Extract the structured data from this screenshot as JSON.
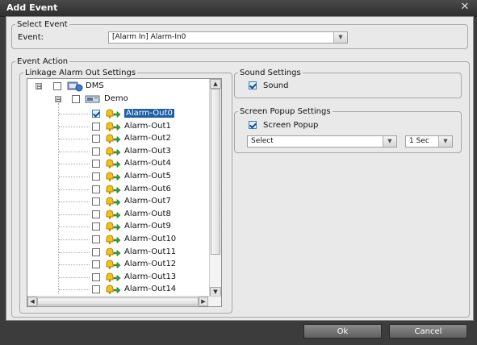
{
  "window": {
    "title": "Add Event",
    "close_glyph": "✕"
  },
  "select_event": {
    "legend": "Select Event",
    "event_label": "Event:",
    "event_value": "[Alarm In] Alarm-In0"
  },
  "event_action": {
    "legend": "Event Action",
    "linkage": {
      "legend": "Linkage Alarm Out Settings",
      "root": {
        "label": "DMS",
        "expander": "⊟"
      },
      "device": {
        "label": "Demo",
        "expander": "⊟"
      },
      "items": [
        {
          "label": "Alarm-Out0",
          "checked": true
        },
        {
          "label": "Alarm-Out1",
          "checked": false
        },
        {
          "label": "Alarm-Out2",
          "checked": false
        },
        {
          "label": "Alarm-Out3",
          "checked": false
        },
        {
          "label": "Alarm-Out4",
          "checked": false
        },
        {
          "label": "Alarm-Out5",
          "checked": false
        },
        {
          "label": "Alarm-Out6",
          "checked": false
        },
        {
          "label": "Alarm-Out7",
          "checked": false
        },
        {
          "label": "Alarm-Out8",
          "checked": false
        },
        {
          "label": "Alarm-Out9",
          "checked": false
        },
        {
          "label": "Alarm-Out10",
          "checked": false
        },
        {
          "label": "Alarm-Out11",
          "checked": false
        },
        {
          "label": "Alarm-Out12",
          "checked": false
        },
        {
          "label": "Alarm-Out13",
          "checked": false
        },
        {
          "label": "Alarm-Out14",
          "checked": false
        }
      ]
    },
    "sound": {
      "legend": "Sound Settings",
      "checkbox_label": "Sound",
      "checked": true
    },
    "popup": {
      "legend": "Screen Popup Settings",
      "checkbox_label": "Screen Popup",
      "checked": true,
      "select_value": "Select",
      "duration_value": "1 Sec"
    }
  },
  "footer": {
    "ok_label": "Ok",
    "cancel_label": "Cancel"
  },
  "colors": {
    "selection": "#1f5fa8",
    "window_frame": "#3c3c3c",
    "client_bg": "#e9e9e9"
  }
}
